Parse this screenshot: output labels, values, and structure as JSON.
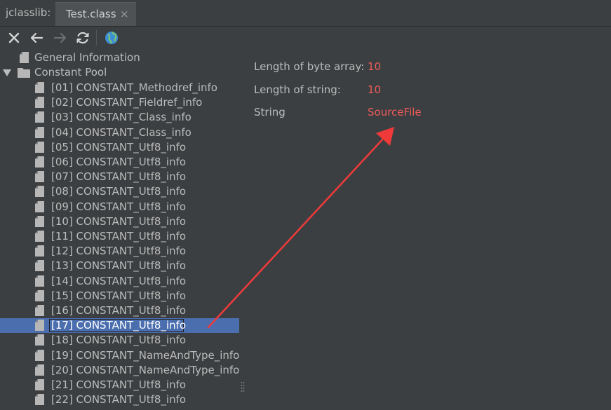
{
  "tabbar": {
    "prefix": "jclasslib:",
    "tab_label": "Test.class",
    "tab_close": "×"
  },
  "toolbar": {
    "icons": [
      "close-icon",
      "back-arrow-icon",
      "forward-arrow-icon",
      "refresh-icon",
      "globe-icon"
    ]
  },
  "tree": {
    "general_info": "General Information",
    "constant_pool": "Constant Pool",
    "items": [
      "[01] CONSTANT_Methodref_info",
      "[02] CONSTANT_Fieldref_info",
      "[03] CONSTANT_Class_info",
      "[04] CONSTANT_Class_info",
      "[05] CONSTANT_Utf8_info",
      "[06] CONSTANT_Utf8_info",
      "[07] CONSTANT_Utf8_info",
      "[08] CONSTANT_Utf8_info",
      "[09] CONSTANT_Utf8_info",
      "[10] CONSTANT_Utf8_info",
      "[11] CONSTANT_Utf8_info",
      "[12] CONSTANT_Utf8_info",
      "[13] CONSTANT_Utf8_info",
      "[14] CONSTANT_Utf8_info",
      "[15] CONSTANT_Utf8_info",
      "[16] CONSTANT_Utf8_info",
      "[17] CONSTANT_Utf8_info",
      "[18] CONSTANT_Utf8_info",
      "[19] CONSTANT_NameAndType_info",
      "[20] CONSTANT_NameAndType_info",
      "[21] CONSTANT_Utf8_info",
      "[22] CONSTANT_Utf8_info"
    ],
    "selected_index": 16
  },
  "detail": {
    "length_byte_array_label": "Length of byte array:",
    "length_byte_array_value": "10",
    "length_string_label": "Length of string:",
    "length_string_value": "10",
    "string_label": "String",
    "string_value": "SourceFile"
  },
  "colors": {
    "background": "#3c3f41",
    "selection": "#4b6eaf",
    "value_text": "#ef5b5b",
    "annotation_arrow": "#f03a3a"
  }
}
